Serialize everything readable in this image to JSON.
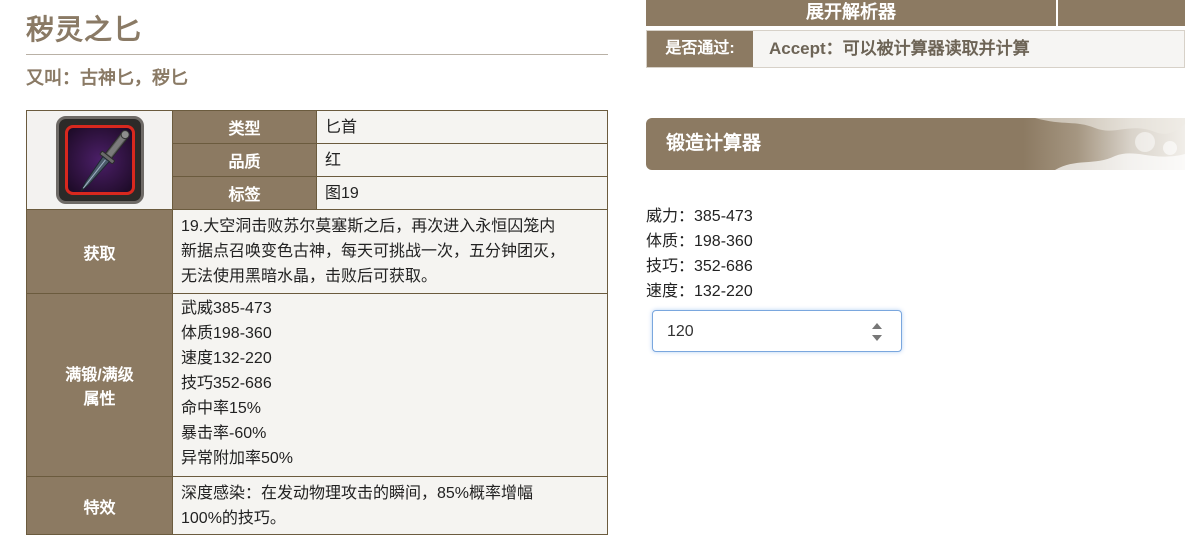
{
  "page": {
    "title": "秽灵之匕",
    "alias": "又叫：古神匕，秽匕"
  },
  "info_table": {
    "rows_small": [
      {
        "header": "类型",
        "value": "匕首"
      },
      {
        "header": "品质",
        "value": "红"
      },
      {
        "header": "标签",
        "value": "图19"
      }
    ],
    "acquire": {
      "header": "获取",
      "lines": [
        "19.大空洞击败苏尔莫塞斯之后，再次进入永恒囚笼内",
        "新据点召唤变色古神，每天可挑战一次，五分钟团灭，",
        "无法使用黑暗水晶，击败后可获取。"
      ]
    },
    "attributes": {
      "header_line1": "满锻/满级",
      "header_line2": "属性",
      "lines": [
        "武威385-473",
        "体质198-360",
        "速度132-220",
        "技巧352-686",
        "命中率15%",
        "暴击率-60%",
        "异常附加率50%"
      ]
    },
    "effect": {
      "header": "特效",
      "lines": [
        "深度感染：在发动物理攻击的瞬间，85%概率增幅",
        "100%的技巧。"
      ]
    }
  },
  "parser": {
    "button_label": "展开解析器",
    "pass_label": "是否通过:",
    "pass_value": "Accept：可以被计算器读取并计算"
  },
  "forge_calculator": {
    "title": "锻造计算器",
    "stats": [
      "威力：385-473",
      "体质：198-360",
      "技巧：352-686",
      "速度：132-220"
    ],
    "input_value": "120"
  },
  "colors": {
    "accent_brown": "#8c7a62",
    "title_brown": "#8a7a65",
    "border_brown": "#6b5b3e",
    "icon_red_frame": "#d8281e"
  },
  "icons": {
    "item": "dagger-item-icon",
    "spinner": "spinner-arrows-icon"
  }
}
